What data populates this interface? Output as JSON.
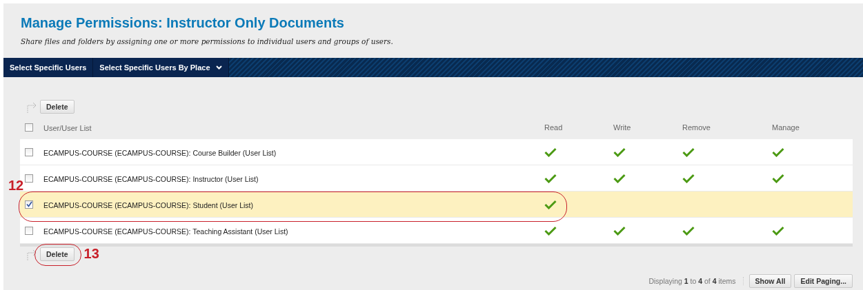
{
  "page": {
    "title": "Manage Permissions: Instructor Only Documents",
    "subtitle": "Share files and folders by assigning one or more permissions to individual users and groups of users."
  },
  "nav": [
    {
      "label": "Select Specific Users",
      "dropdown": false
    },
    {
      "label": "Select Specific Users By Place",
      "dropdown": true
    }
  ],
  "top_action": {
    "label": "Delete"
  },
  "table": {
    "columns": [
      "User/User List",
      "Read",
      "Write",
      "Remove",
      "Manage"
    ],
    "select_all_checked": false,
    "rows": [
      {
        "name": "ECAMPUS-COURSE (ECAMPUS-COURSE): Course Builder (User List)",
        "checked": false,
        "selected": false,
        "perms": [
          true,
          true,
          true,
          true
        ]
      },
      {
        "name": "ECAMPUS-COURSE (ECAMPUS-COURSE): Instructor (User List)",
        "checked": false,
        "selected": false,
        "perms": [
          true,
          true,
          true,
          true
        ]
      },
      {
        "name": "ECAMPUS-COURSE (ECAMPUS-COURSE): Student (User List)",
        "checked": true,
        "selected": true,
        "perms": [
          true,
          false,
          false,
          false
        ],
        "callout": "12"
      },
      {
        "name": "ECAMPUS-COURSE (ECAMPUS-COURSE): Teaching Assistant (User List)",
        "checked": false,
        "selected": false,
        "perms": [
          true,
          true,
          true,
          true
        ]
      }
    ]
  },
  "bottom_action": {
    "label": "Delete",
    "callout": "13"
  },
  "paging": {
    "summary": "Displaying **1** to **4** of **4** items",
    "buttons": [
      "Show All",
      "Edit Paging..."
    ]
  }
}
